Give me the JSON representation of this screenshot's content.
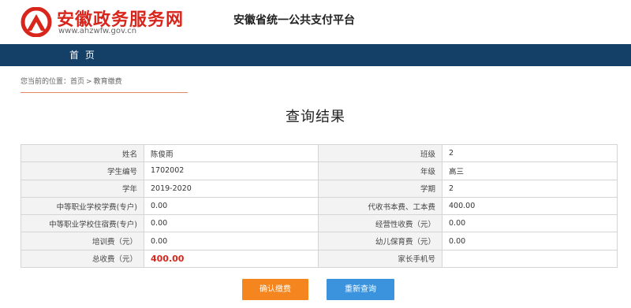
{
  "header": {
    "site_title": "安徽政务服务网",
    "site_url": "www.ahzwfw.gov.cn",
    "platform_title": "安徽省统一公共支付平台",
    "logo_color": "#d9261c"
  },
  "nav": {
    "home_label": "首 页",
    "bar_color": "#143f66"
  },
  "breadcrumb": {
    "prefix": "您当前的位置：",
    "home": "首页",
    "separator": ">",
    "current": "教育缴费"
  },
  "result_title": "查询结果",
  "table": {
    "rows": [
      {
        "left_label": "姓名",
        "left_value": "陈俊雨",
        "right_label": "班级",
        "right_value": "2"
      },
      {
        "left_label": "学生编号",
        "left_value": "1702002",
        "right_label": "年级",
        "right_value": "高三"
      },
      {
        "left_label": "学年",
        "left_value": "2019-2020",
        "right_label": "学期",
        "right_value": "2"
      },
      {
        "left_label": "中等职业学校学费(专户)",
        "left_value": "0.00",
        "right_label": "代收书本费、工本费",
        "right_value": "400.00"
      },
      {
        "left_label": "中等职业学校住宿费(专户)",
        "left_value": "0.00",
        "right_label": "经营性收费（元）",
        "right_value": "0.00"
      },
      {
        "left_label": "培训费（元）",
        "left_value": "0.00",
        "right_label": "幼儿保育费（元）",
        "right_value": "0.00"
      },
      {
        "left_label": "总收费（元）",
        "left_value": "400.00",
        "right_label": "家长手机号",
        "right_value": ""
      }
    ]
  },
  "buttons": {
    "confirm_label": "确认缴费",
    "requery_label": "重新查询",
    "confirm_color": "#f4851f",
    "requery_color": "#3a93dc"
  }
}
